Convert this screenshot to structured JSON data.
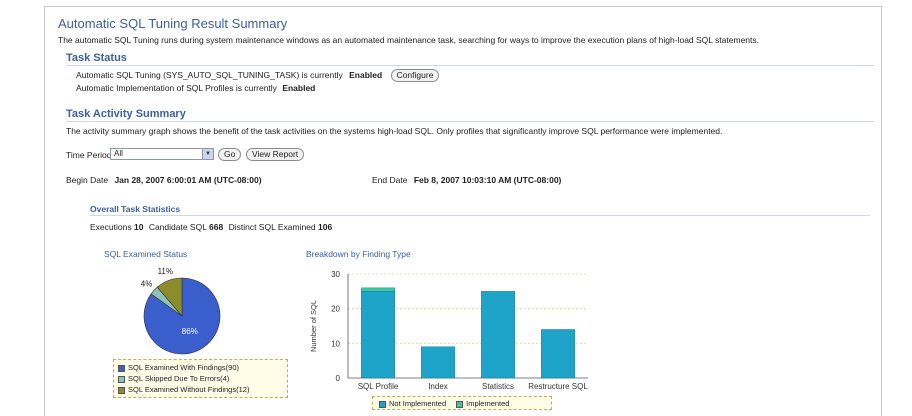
{
  "page": {
    "title": "Automatic SQL Tuning Result Summary",
    "intro": "The automatic SQL Tuning runs during system maintenance windows as an automated maintenance task, searching for ways to improve the execution plans of high-load SQL statements."
  },
  "task_status": {
    "heading": "Task Status",
    "line1_prefix": "Automatic SQL Tuning (SYS_AUTO_SQL_TUNING_TASK) is currently",
    "line1_state": "Enabled",
    "configure_label": "Configure",
    "line2_prefix": "Automatic Implementation of SQL Profiles is currently",
    "line2_state": "Enabled"
  },
  "activity": {
    "heading": "Task Activity Summary",
    "description": "The activity summary graph shows the benefit of the task activities on the systems high-load SQL. Only profiles that significantly improve SQL performance were implemented.",
    "time_period_label": "Time Period",
    "time_period_value": "All",
    "go_label": "Go",
    "view_report_label": "View Report",
    "begin_label": "Begin Date",
    "begin_value": "Jan 28, 2007 6:00:01 AM (UTC-08:00)",
    "end_label": "End Date",
    "end_value": "Feb 8, 2007 10:03:10 AM (UTC-08:00)"
  },
  "stats": {
    "heading": "Overall Task Statistics",
    "executions_label": "Executions",
    "executions_value": "10",
    "candidate_label": "Candidate SQL",
    "candidate_value": "668",
    "distinct_label": "Distinct SQL Examined",
    "distinct_value": "106"
  },
  "colors": {
    "with_findings": "#3a5fcd",
    "skipped": "#8fc3b6",
    "without_findings": "#8c8c2a",
    "not_implemented": "#1ea3c9",
    "implemented": "#38c9a0"
  },
  "chart_data": [
    {
      "type": "pie",
      "title": "SQL Examined Status",
      "slices": [
        {
          "name": "SQL Examined With Findings(90)",
          "value": 90,
          "label": "86%",
          "color": "#3a5fcd"
        },
        {
          "name": "SQL Skipped Due To Errors(4)",
          "value": 4,
          "label": "4%",
          "color": "#8fc3b6"
        },
        {
          "name": "SQL Examined Without Findings(12)",
          "value": 12,
          "label": "11%",
          "color": "#8c8c2a"
        }
      ],
      "legend_position": "bottom"
    },
    {
      "type": "bar",
      "title": "Breakdown by Finding Type",
      "ylabel": "Number of SQL",
      "categories": [
        "SQL Profile",
        "Index",
        "Statistics",
        "Restructure SQL"
      ],
      "series": [
        {
          "name": "Not Implemented",
          "values": [
            25,
            9,
            25,
            14
          ],
          "color": "#1ea3c9"
        },
        {
          "name": "Implemented",
          "values": [
            1,
            0,
            0,
            0
          ],
          "color": "#38c9a0"
        }
      ],
      "yticks": [
        "0",
        "10",
        "20",
        "30"
      ],
      "ylim": [
        0,
        30
      ],
      "grid": true,
      "legend_position": "bottom"
    }
  ]
}
